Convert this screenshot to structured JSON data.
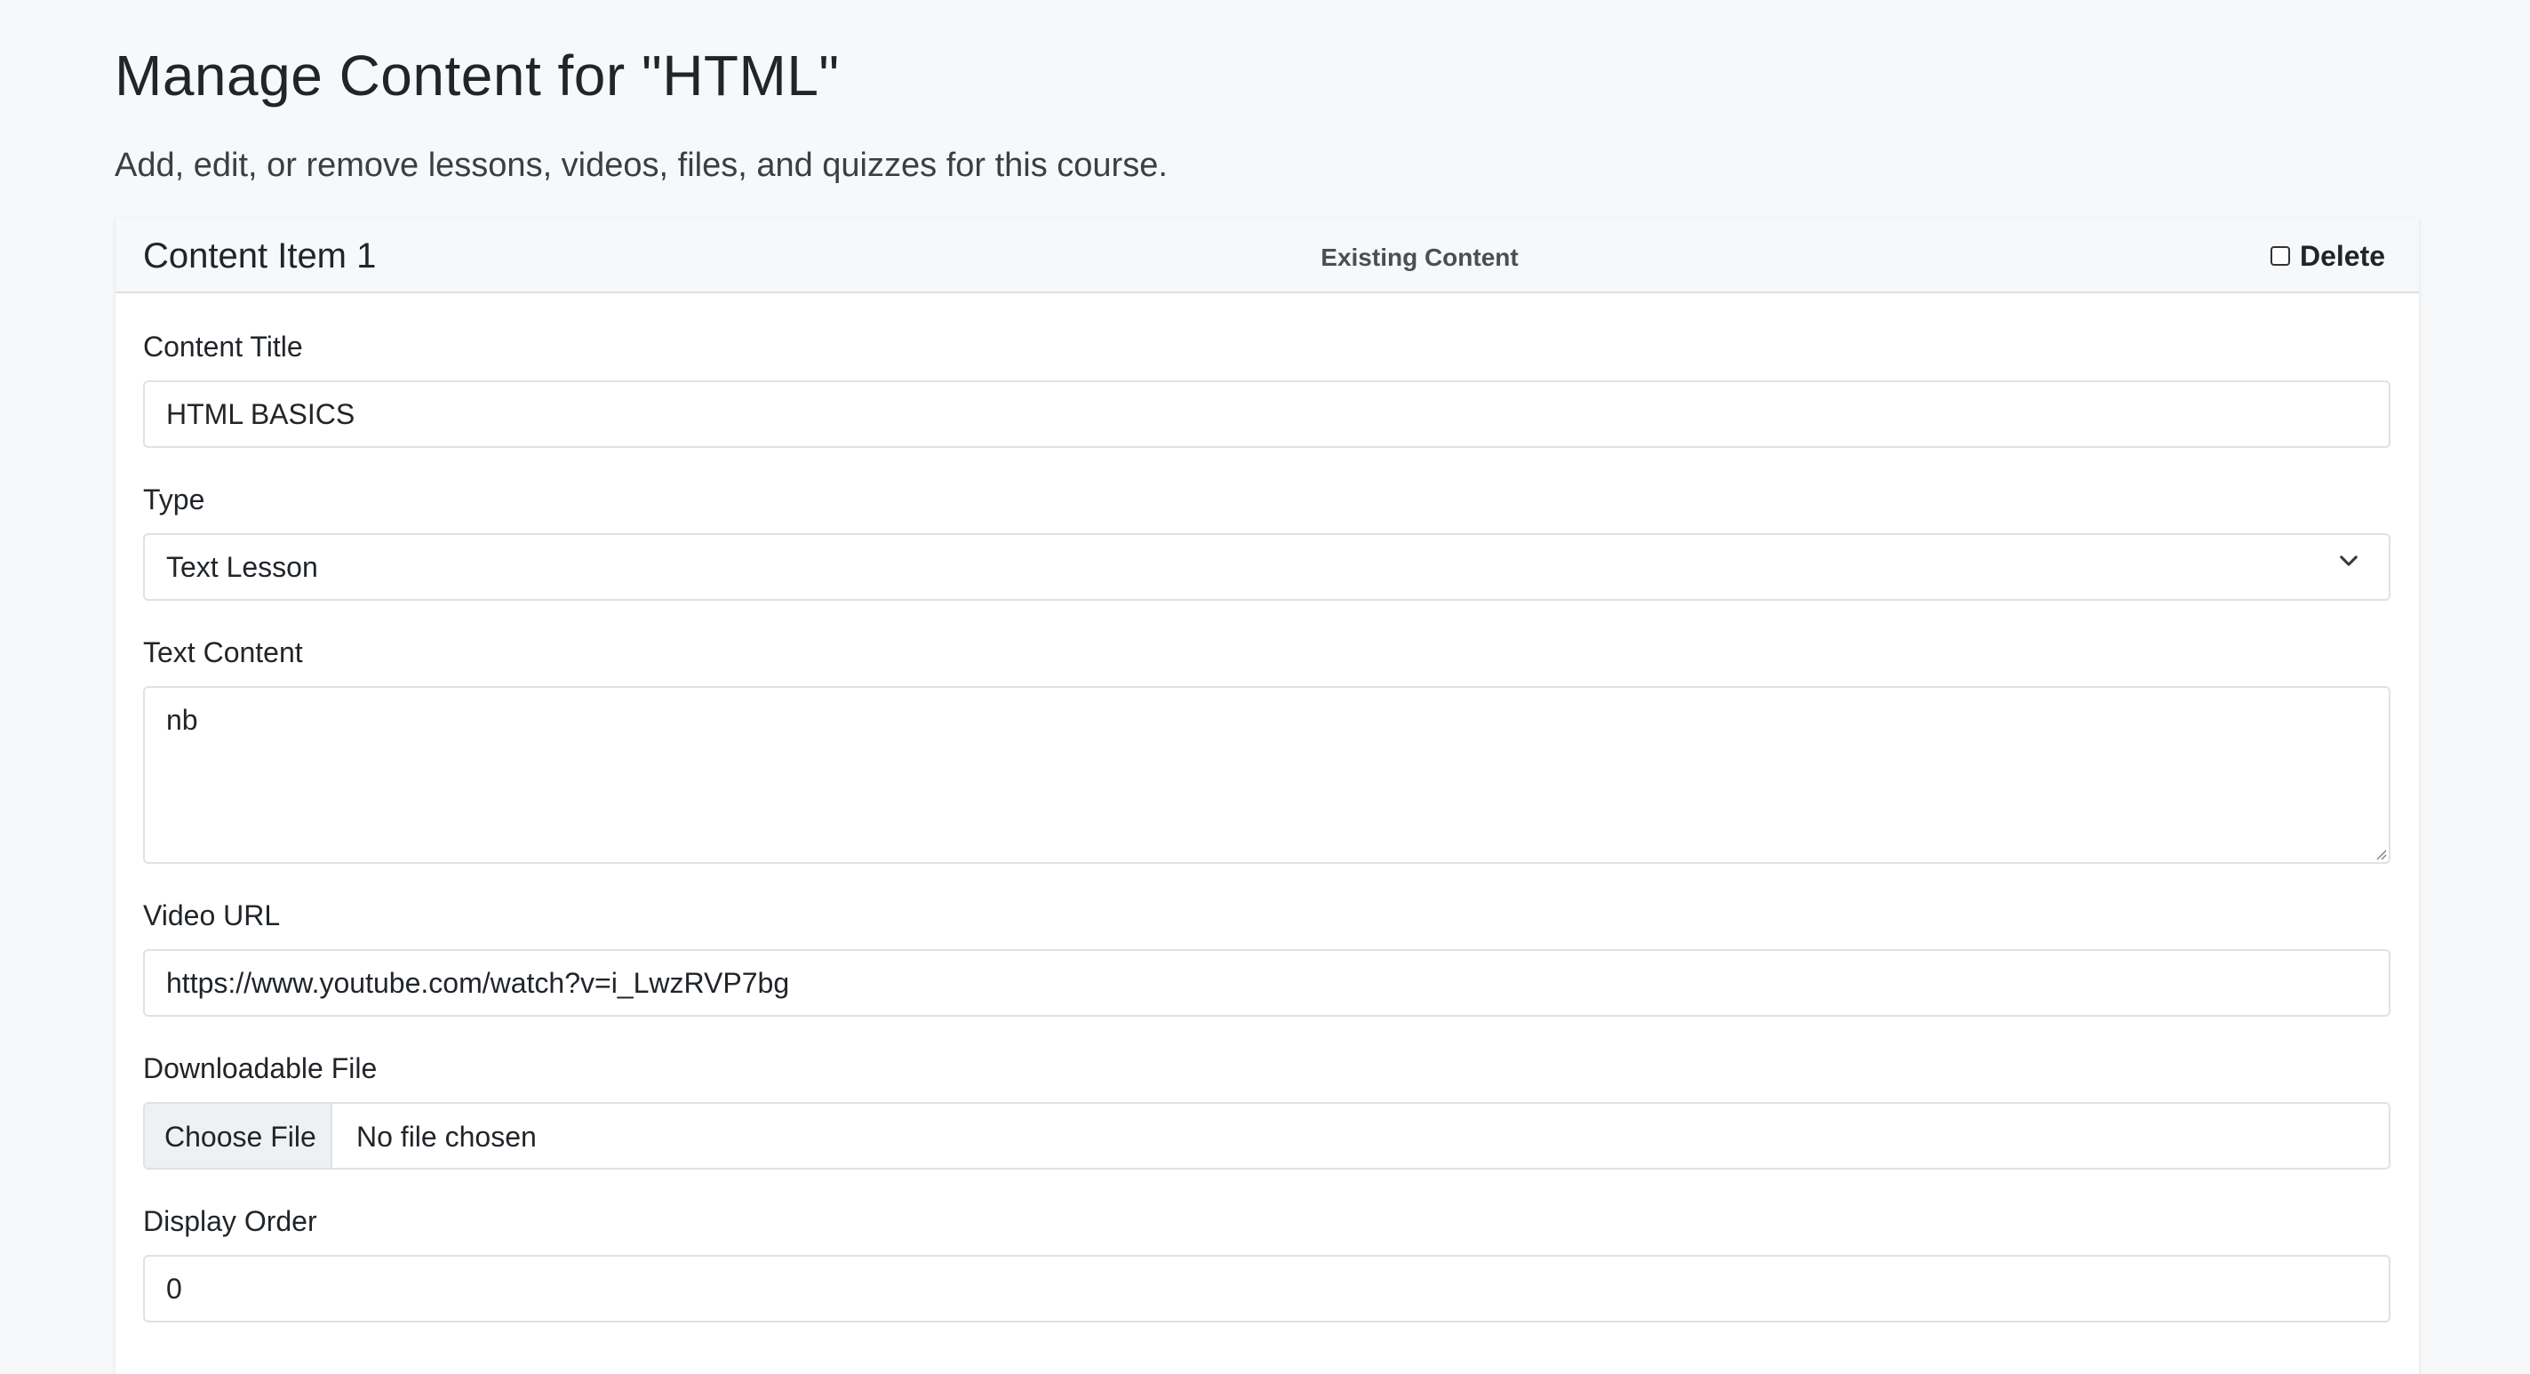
{
  "page": {
    "title": "Manage Content for \"HTML\"",
    "subtitle": "Add, edit, or remove lessons, videos, files, and quizzes for this course."
  },
  "content_item": {
    "heading": "Content Item 1",
    "status": "Existing Content",
    "delete_label": "Delete",
    "delete_checked": false,
    "title_field": {
      "label": "Content Title",
      "value": "HTML BASICS"
    },
    "type_field": {
      "label": "Type",
      "selected": "Text Lesson"
    },
    "text_content_field": {
      "label": "Text Content",
      "value": "nb"
    },
    "video_url_field": {
      "label": "Video URL",
      "value": "https://www.youtube.com/watch?v=i_LwzRVP7bg"
    },
    "file_field": {
      "label": "Downloadable File",
      "button_label": "Choose File",
      "status": "No file chosen"
    },
    "display_order_field": {
      "label": "Display Order",
      "value": "0"
    }
  },
  "icons": {
    "select_arrow": "chevron-down-icon",
    "resize": "resize-grip-icon"
  },
  "colors": {
    "page_background": "#f7f8fa",
    "card_header_background": "#f7f8f9",
    "border": "#dee2e6",
    "text": "#212529"
  }
}
